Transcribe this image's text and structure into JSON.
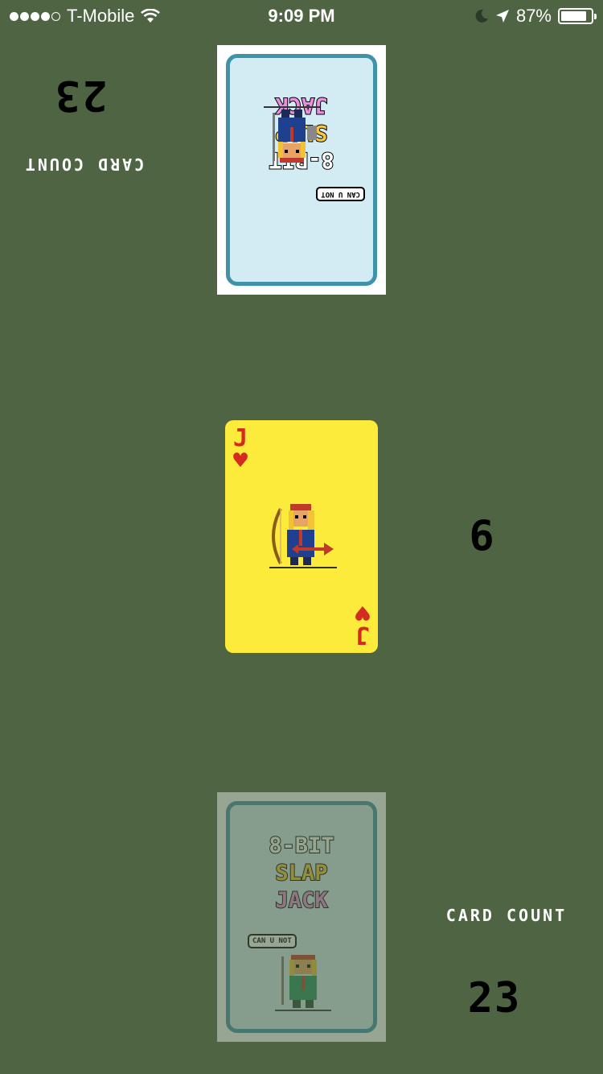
{
  "status_bar": {
    "carrier": "T-Mobile",
    "time": "9:09 PM",
    "battery": "87%",
    "battery_level": 0.87,
    "signal_bars_filled": 4,
    "signal_bars_total": 5
  },
  "opponent": {
    "card_count_label": "CARD COUNT",
    "card_count": "23"
  },
  "my_player": {
    "card_count_label": "CARD COUNT",
    "card_count": "23"
  },
  "pile": {
    "count": "6",
    "top_card": {
      "rank": "J",
      "suit": "♥",
      "suit_color": "#d42a20",
      "face_color": "#fdeb3b"
    }
  },
  "deck_back": {
    "title_lines": [
      "8-BIT",
      "SLAP",
      "JACK"
    ],
    "speech": "CAN U NOT"
  },
  "colors": {
    "background": "#4e6443",
    "deck_border": "#3f93a9",
    "deck_face": "#d3ecf3"
  }
}
